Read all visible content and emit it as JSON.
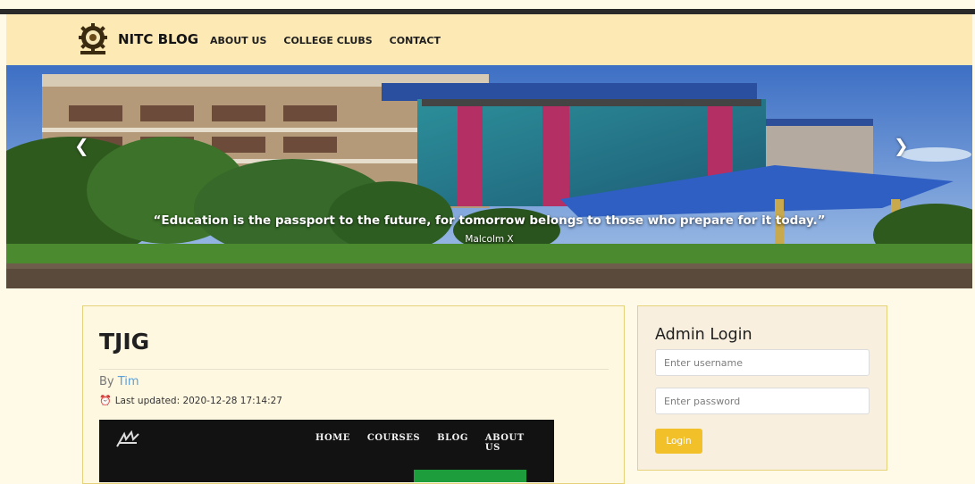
{
  "navbar": {
    "brand": "NITC BLOG",
    "links": [
      "ABOUT US",
      "COLLEGE CLUBS",
      "CONTACT"
    ]
  },
  "hero": {
    "quote": "“Education is the passport to the future, for tomorrow belongs to those who prepare for it today.”",
    "author": "Malcolm X",
    "prev_icon": "chevron-left",
    "next_icon": "chevron-right"
  },
  "post": {
    "title": "TJIG",
    "by_prefix": "By",
    "author": "Tim",
    "last_updated": "Last updated: 2020-12-28 17:14:27",
    "preview_nav": [
      "HOME",
      "COURSES",
      "BLOG",
      "ABOUT US"
    ]
  },
  "login": {
    "title": "Admin Login",
    "username_placeholder": "Enter username",
    "password_placeholder": "Enter password",
    "button": "Login"
  },
  "colors": {
    "navbar_bg": "#fde9b4",
    "page_bg": "#fff9e8",
    "accent": "#f2c029",
    "link": "#5aa0d8"
  }
}
